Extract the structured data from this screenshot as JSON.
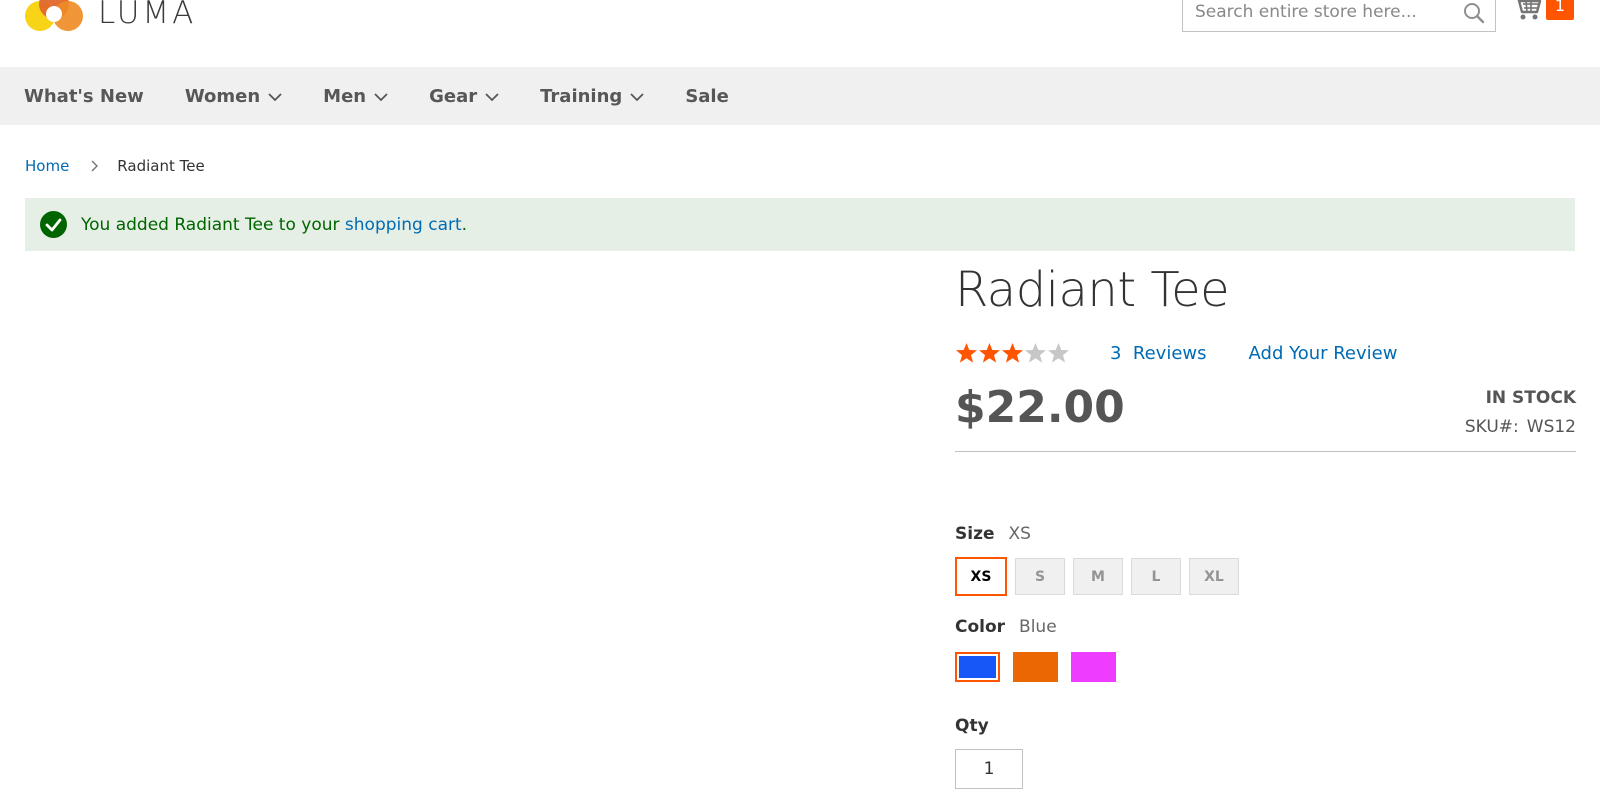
{
  "header": {
    "logo_text": "LUMA",
    "search_placeholder": "Search entire store here...",
    "cart_count": "1"
  },
  "nav": {
    "items": [
      {
        "label": "What's New",
        "has_dropdown": false
      },
      {
        "label": "Women",
        "has_dropdown": true
      },
      {
        "label": "Men",
        "has_dropdown": true
      },
      {
        "label": "Gear",
        "has_dropdown": true
      },
      {
        "label": "Training",
        "has_dropdown": true
      },
      {
        "label": "Sale",
        "has_dropdown": false
      }
    ]
  },
  "breadcrumb": {
    "home": "Home",
    "current": "Radiant Tee"
  },
  "message": {
    "prefix": "You added Radiant Tee to your ",
    "link": "shopping cart",
    "suffix": "."
  },
  "product": {
    "title": "Radiant Tee",
    "rating_stars": 3,
    "rating_max": 5,
    "reviews_count": "3",
    "reviews_label": "Reviews",
    "add_review_label": "Add Your Review",
    "price": "$22.00",
    "stock": "IN STOCK",
    "sku_label": "SKU#:",
    "sku": "WS12"
  },
  "options": {
    "size_label": "Size",
    "size_selected": "XS",
    "sizes": [
      "XS",
      "S",
      "M",
      "L",
      "XL"
    ],
    "color_label": "Color",
    "color_selected": "Blue",
    "colors": [
      {
        "name": "Blue",
        "hex": "#1857f7"
      },
      {
        "name": "Orange",
        "hex": "#eb6703"
      },
      {
        "name": "Purple",
        "hex": "#ef3dff"
      }
    ],
    "qty_label": "Qty",
    "qty_value": "1"
  },
  "colors": {
    "accent": "#ff5501",
    "link": "#006bb4",
    "success_bg": "#e5efe5",
    "success_text": "#006400",
    "star_filled": "#ff5501",
    "star_empty": "#c7c7c7"
  }
}
